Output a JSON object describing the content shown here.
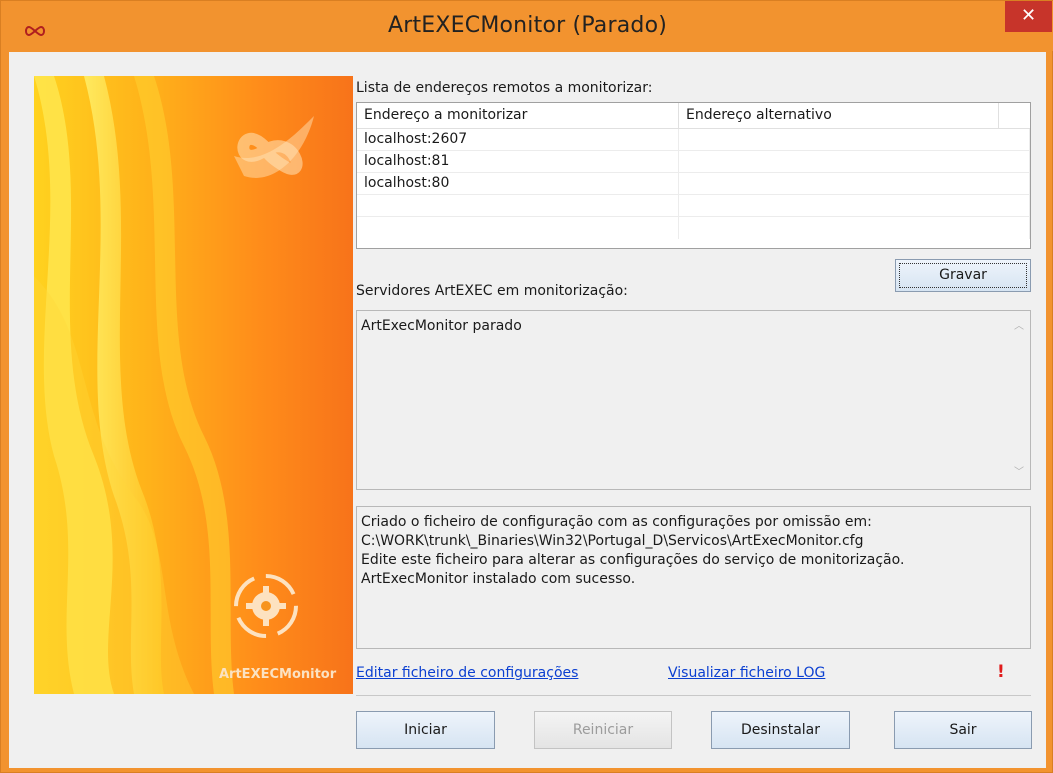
{
  "window": {
    "title": "ArtEXECMonitor (Parado)",
    "close_glyph": "✕"
  },
  "banner": {
    "caption": "ArtEXECMonitor"
  },
  "addresses": {
    "label": "Lista de endereços remotos a monitorizar:",
    "columns": [
      "Endereço a monitorizar",
      "Endereço alternativo"
    ],
    "rows": [
      [
        "localhost:2607",
        ""
      ],
      [
        "localhost:81",
        ""
      ],
      [
        "localhost:80",
        ""
      ],
      [
        "",
        ""
      ],
      [
        "",
        ""
      ]
    ]
  },
  "buttons": {
    "save": "Gravar",
    "start": "Iniciar",
    "restart": "Reiniciar",
    "uninstall": "Desinstalar",
    "exit": "Sair"
  },
  "servers": {
    "label": "Servidores ArtEXEC em monitorização:",
    "text": "ArtExecMonitor parado"
  },
  "log": {
    "lines": [
      "Criado o ficheiro de configuração com as configurações por omissão em:",
      "C:\\WORK\\trunk\\_Binaries\\Win32\\Portugal_D\\Servicos\\ArtExecMonitor.cfg",
      "Edite este ficheiro para alterar as configurações do serviço de monitorização.",
      "ArtExecMonitor instalado com sucesso."
    ]
  },
  "links": {
    "edit_config": "Editar ficheiro de configurações",
    "view_log": "Visualizar ficheiro LOG",
    "warning": "!"
  },
  "colors": {
    "titlebar": "#f2932f",
    "close": "#c7342a",
    "link": "#0b3fd1",
    "warning": "#e01b1b"
  }
}
